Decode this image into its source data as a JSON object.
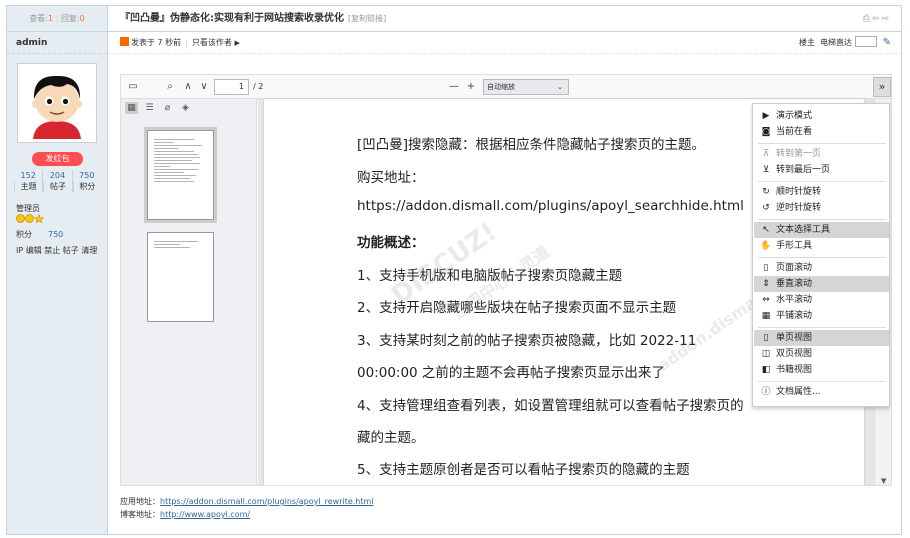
{
  "stats": {
    "view_label": "查看:",
    "view_count": "1",
    "sep": "|",
    "reply_label": "回复:",
    "reply_count": "0"
  },
  "author": {
    "name": "admin",
    "red_packet": "发红包",
    "stats": [
      {
        "value": "152",
        "label": "主题"
      },
      {
        "value": "204",
        "label": "帖子"
      },
      {
        "value": "750",
        "label": "积分"
      }
    ],
    "group": "管理员",
    "score_label": "积分",
    "score_value": "750",
    "actions": "IP 编辑 禁止 帖子 清理"
  },
  "thread": {
    "title": "『凹凸曼』伪静态化:实现有利于网站搜索收录优化",
    "copy_link": "[复制链接]"
  },
  "post": {
    "posted": "发表于 7 秒前",
    "sep": "|",
    "only_author": "只看该作者",
    "floor": "楼主",
    "elevator": "电梯直达"
  },
  "viewer": {
    "page_value": "1",
    "page_count": "/ 2",
    "zoom": "自动缩放",
    "zoom_minus": "—",
    "zoom_plus": "+"
  },
  "page_lines": [
    "[凹凸曼]搜索隐藏：根据相应条件隐藏帖子搜索页的主题。",
    "购买地址：",
    "https://addon.dismall.com/plugins/apoyl_searchhide.html",
    "功能概述：",
    "1、支持手机版和电脑版帖子搜索页隐藏主题",
    "2、支持开启隐藏哪些版块在帖子搜索页面不显示主题",
    "3、支持某时刻之前的帖子搜索页被隐藏，比如  2022-11",
    "00:00:00 之前的主题不会再帖子搜索页显示出来了",
    "4、支持管理组查看列表，如设置管理组就可以查看帖子搜索页的",
    "藏的主题。",
    "5、支持主题原创者是否可以看帖子搜索页的隐藏的主题"
  ],
  "watermark": {
    "brand": "DISCUZ!",
    "cn": "应用中心 | 灵道",
    "url": "addon.dismall.com"
  },
  "menu": {
    "presentation": "演示模式",
    "current_view": "当前在看",
    "first_page": "转到第一页",
    "last_page": "转到最后一页",
    "rotate_cw": "顺时针旋转",
    "rotate_ccw": "逆时针旋转",
    "text_select": "文本选择工具",
    "hand_tool": "手形工具",
    "page_scroll": "页面滚动",
    "vertical_scroll": "垂直滚动",
    "horizontal_scroll": "水平滚动",
    "wrapped_scroll": "平铺滚动",
    "single_page": "单页视图",
    "double_page": "双页视图",
    "book_view": "书籍视图",
    "doc_props": "文档属性..."
  },
  "footer": {
    "app_label": "应用地址：",
    "app_url": "https://addon.dismall.com/plugins/apoyl_rewrite.html",
    "blog_label": "博客地址：",
    "blog_url": "http://www.apoyl.com/"
  },
  "colors": {
    "border": "#c2d5e3",
    "sidebar_bg": "#e5edf2",
    "red_btn": "#ff4e52",
    "link": "#336699",
    "menu_highlight": "#d5d5d5"
  }
}
